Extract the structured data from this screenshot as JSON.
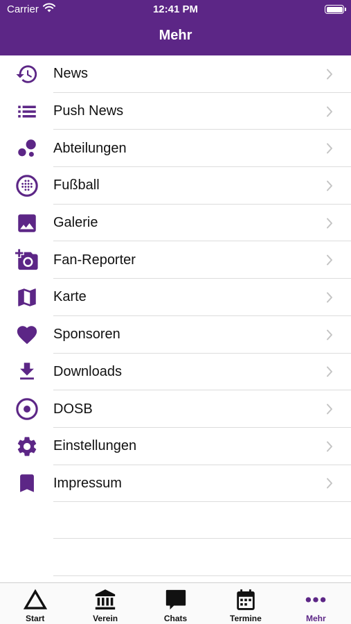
{
  "status_bar": {
    "carrier": "Carrier",
    "time": "12:41 PM"
  },
  "header": {
    "title": "Mehr"
  },
  "colors": {
    "brand": "#5c2686",
    "separator": "#dcdcdc",
    "chevron": "#c4c4c4"
  },
  "menu": {
    "items": [
      {
        "label": "News",
        "icon": "history-icon"
      },
      {
        "label": "Push News",
        "icon": "list-icon"
      },
      {
        "label": "Abteilungen",
        "icon": "bubbles-icon"
      },
      {
        "label": "Fußball",
        "icon": "football-icon"
      },
      {
        "label": "Galerie",
        "icon": "image-icon"
      },
      {
        "label": "Fan-Reporter",
        "icon": "add-camera-icon"
      },
      {
        "label": "Karte",
        "icon": "map-icon"
      },
      {
        "label": "Sponsoren",
        "icon": "heart-icon"
      },
      {
        "label": "Downloads",
        "icon": "download-icon"
      },
      {
        "label": "DOSB",
        "icon": "target-icon"
      },
      {
        "label": "Einstellungen",
        "icon": "gear-icon"
      },
      {
        "label": "Impressum",
        "icon": "bookmark-icon"
      }
    ]
  },
  "tabbar": {
    "tabs": [
      {
        "label": "Start",
        "icon": "triangle-icon"
      },
      {
        "label": "Verein",
        "icon": "bank-icon"
      },
      {
        "label": "Chats",
        "icon": "chat-icon"
      },
      {
        "label": "Termine",
        "icon": "calendar-icon"
      },
      {
        "label": "Mehr",
        "icon": "more-icon",
        "active": true
      }
    ]
  }
}
